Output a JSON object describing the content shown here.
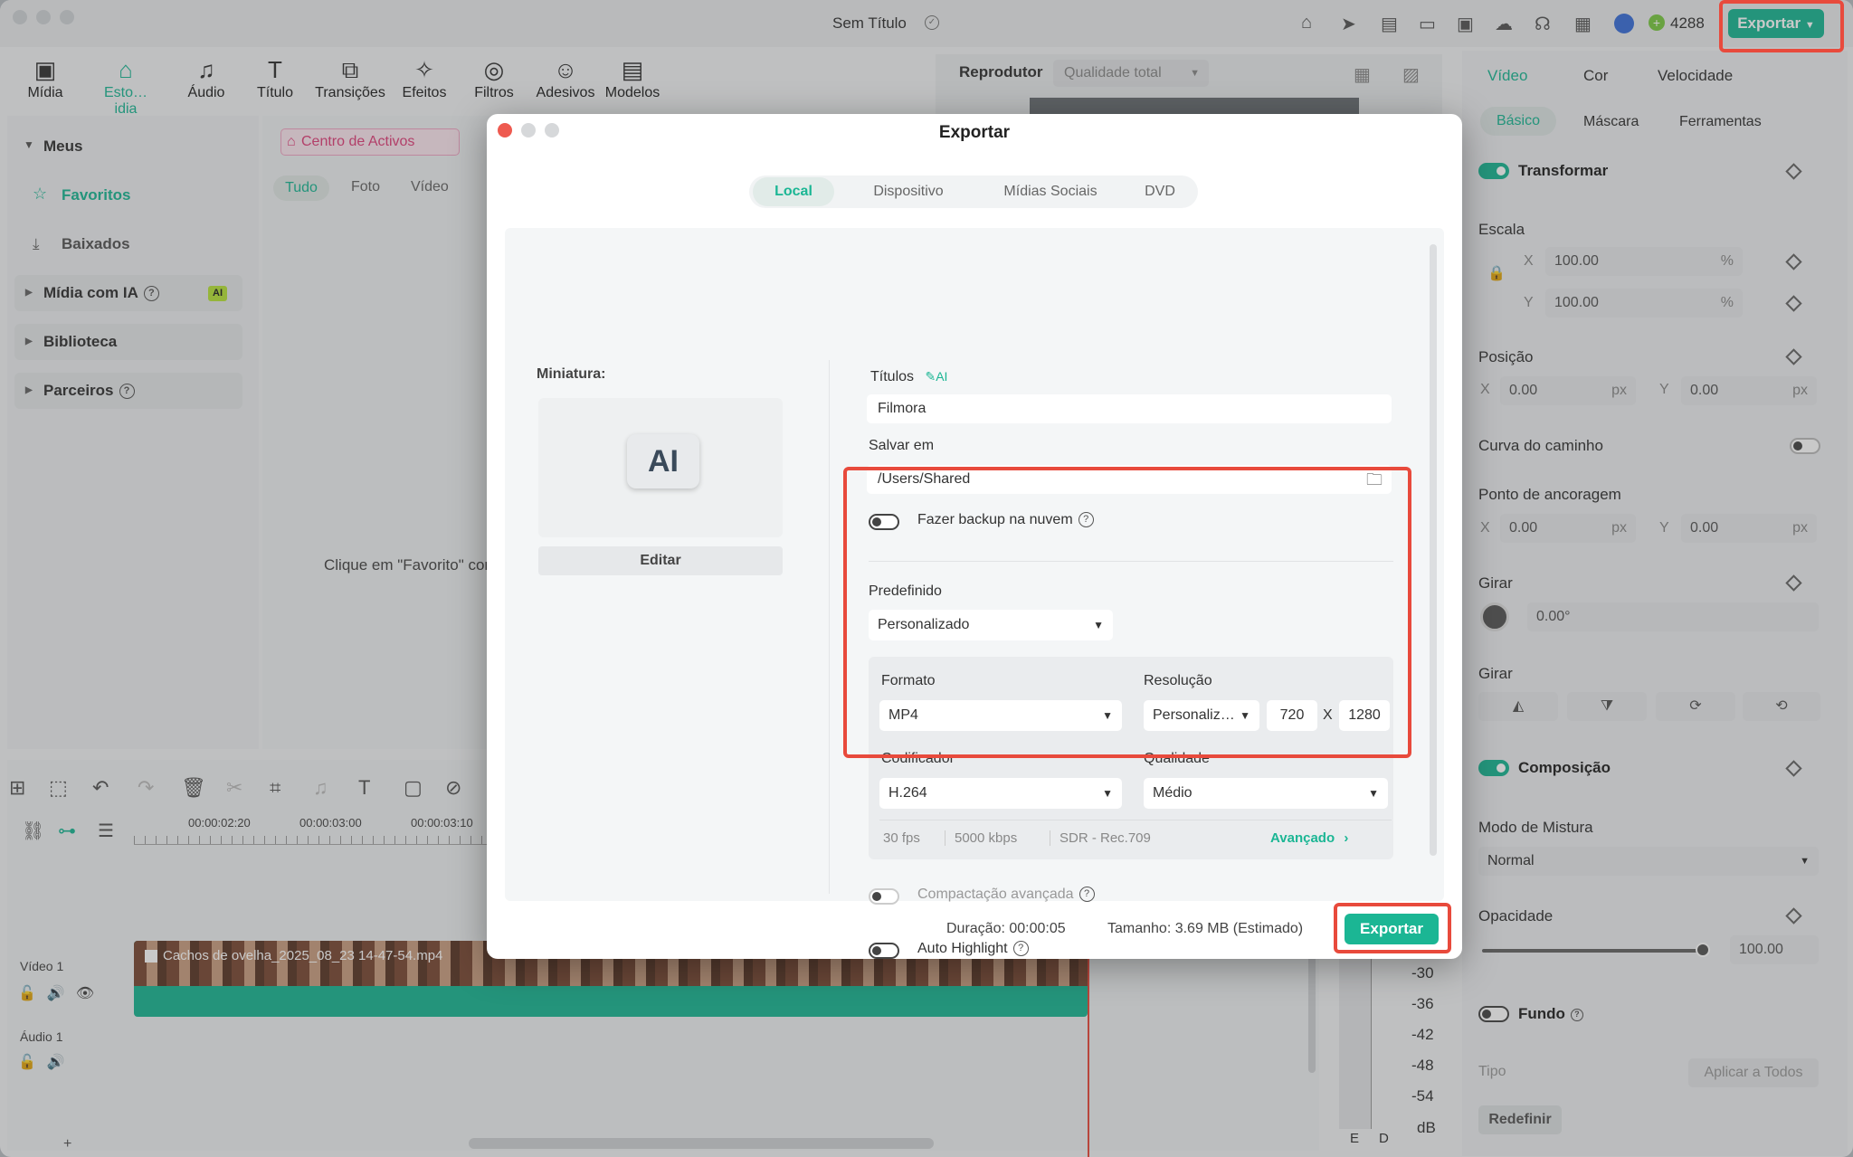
{
  "window": {
    "title": "Sem Título",
    "credits": "4288",
    "export_label": "Exportar"
  },
  "toolbar": [
    {
      "label": "Mídia",
      "icon": "media-icon"
    },
    {
      "label": "Esto…idia",
      "icon": "stock-media-icon"
    },
    {
      "label": "Áudio",
      "icon": "audio-icon"
    },
    {
      "label": "Título",
      "icon": "title-icon"
    },
    {
      "label": "Transições",
      "icon": "transitions-icon"
    },
    {
      "label": "Efeitos",
      "icon": "effects-icon"
    },
    {
      "label": "Filtros",
      "icon": "filters-icon"
    },
    {
      "label": "Adesivos",
      "icon": "stickers-icon"
    },
    {
      "label": "Modelos",
      "icon": "templates-icon"
    }
  ],
  "left_panel": {
    "meus": "Meus",
    "favoritos": "Favoritos",
    "baixados": "Baixados",
    "midia_ia": "Mídia com IA",
    "ai_badge": "AI",
    "biblioteca": "Biblioteca",
    "parceiros": "Parceiros"
  },
  "media_panel": {
    "centro": "Centro de Activos",
    "filters": [
      "Tudo",
      "Foto",
      "Vídeo"
    ],
    "hint": "Clique em \"Favorito\" com"
  },
  "player": {
    "label": "Reprodutor",
    "quality": "Qualidade total"
  },
  "timeline": {
    "times": [
      "00:00:02:20",
      "00:00:03:00",
      "00:00:03:10"
    ],
    "video_track": "Vídeo 1",
    "audio_track": "Áudio 1",
    "clip_name": "Cachos de ovelha_2025_08_23 14-47-54.mp4",
    "add": "+"
  },
  "meter": {
    "labels": [
      "-30",
      "-36",
      "-42",
      "-48",
      "-54",
      "dB"
    ],
    "channels": [
      "E",
      "D"
    ]
  },
  "dialog": {
    "title": "Exportar",
    "tabs": [
      "Local",
      "Dispositivo",
      "Mídias Sociais",
      "DVD"
    ],
    "thumbnail_label": "Miniatura:",
    "edit_label": "Editar",
    "titulos_label": "Títulos",
    "titulos_value": "Filmora",
    "salvar_label": "Salvar em",
    "salvar_value": "/Users/Shared",
    "backup_label": "Fazer backup na nuvem",
    "predefinido_label": "Predefinido",
    "predefinido_value": "Personalizado",
    "formato_label": "Formato",
    "formato_value": "MP4",
    "resolucao_label": "Resolução",
    "resolucao_value": "Personaliz…",
    "res_w": "720",
    "res_x": "X",
    "res_h": "1280",
    "codificador_label": "Codificador",
    "codificador_value": "H.264",
    "qualidade_label": "Qualidade",
    "qualidade_value": "Médio",
    "fps": "30 fps",
    "bitrate": "5000 kbps",
    "color": "SDR - Rec.709",
    "avancado": "Avançado",
    "compactacao_label": "Compactação avançada",
    "highlight_label": "Auto Highlight",
    "duracao": "Duração: 00:00:05",
    "tamanho": "Tamanho: 3.69 MB (Estimado)",
    "export_button": "Exportar"
  },
  "right_panel": {
    "tabs": [
      "Vídeo",
      "Cor",
      "Velocidade"
    ],
    "subtabs": [
      "Básico",
      "Máscara",
      "Ferramentas"
    ],
    "transformar": "Transformar",
    "escala": "Escala",
    "scale_x": "100.00",
    "scale_y": "100.00",
    "pct": "%",
    "x": "X",
    "y": "Y",
    "posicao": "Posição",
    "pos_x": "0.00",
    "pos_y": "0.00",
    "px": "px",
    "curva": "Curva do caminho",
    "ancoragem": "Ponto de ancoragem",
    "anc_x": "0.00",
    "anc_y": "0.00",
    "girar": "Girar",
    "rot_value": "0.00°",
    "girar2": "Girar",
    "composicao": "Composição",
    "modo": "Modo de Mistura",
    "modo_value": "Normal",
    "opacidade": "Opacidade",
    "opacity_value": "100.00",
    "fundo": "Fundo",
    "tipo": "Tipo",
    "aplicar": "Aplicar a Todos",
    "redefinir": "Redefinir"
  },
  "colors": {
    "accent": "#1bb694",
    "highlight": "#e84a3c"
  }
}
